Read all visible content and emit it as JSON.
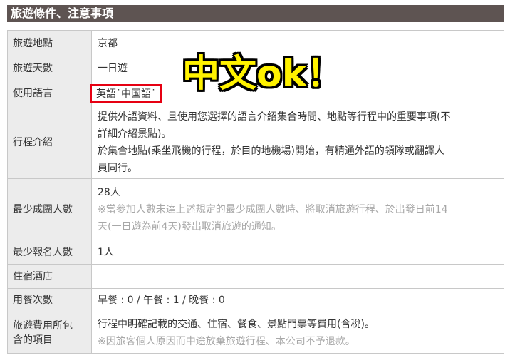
{
  "header": {
    "title": "旅遊條件、注意事項"
  },
  "overlay": {
    "text": "中文ok！"
  },
  "rows": {
    "location": {
      "label": "旅遊地點",
      "value": "京都"
    },
    "days": {
      "label": "旅遊天數",
      "value": "一日遊"
    },
    "language": {
      "label": "使用語言",
      "value": "英語˙中国語˙"
    },
    "itinerary": {
      "label": "行程介紹",
      "line1": "提供外語資料、且使用您選擇的語言介紹集合時間、地點等行程中的重要事項(不",
      "line2": "詳細介紹景點)。",
      "line3": "於集合地點(乘坐飛機的行程，於目的地機場)開始，有精通外語的領隊或翻譯人",
      "line4": "員同行。"
    },
    "min_group": {
      "label": "最少成團人數",
      "value": "28人",
      "note1": "※當參加人數未達上述規定的最少成團人數時、將取消旅遊行程、於出發日前14",
      "note2": "天(一日遊為前4天)發出取消旅遊的通知。"
    },
    "min_signup": {
      "label": "最少報名人數",
      "value": "1人"
    },
    "hotel": {
      "label": "住宿酒店",
      "value": ""
    },
    "meals": {
      "label": "用餐次數",
      "value": "早餐 : 0 / 午餐 : 1 / 晚餐 : 0"
    },
    "fee": {
      "label_line1": "旅遊費用所包",
      "label_line2": "含的項目",
      "value": "行程中明確記載的交通、住宿、餐食、景點門票等費用(含稅)。",
      "note": "※因旅客個人原因而中途放棄旅遊行程、本公司不予退款。"
    }
  },
  "colors": {
    "header_bg": "#5e5452",
    "label_bg": "#ececec",
    "border": "#c8c8c8",
    "highlight_box": "#e60012",
    "overlay_text": "#fff200",
    "note_text": "#a8a8a8"
  }
}
